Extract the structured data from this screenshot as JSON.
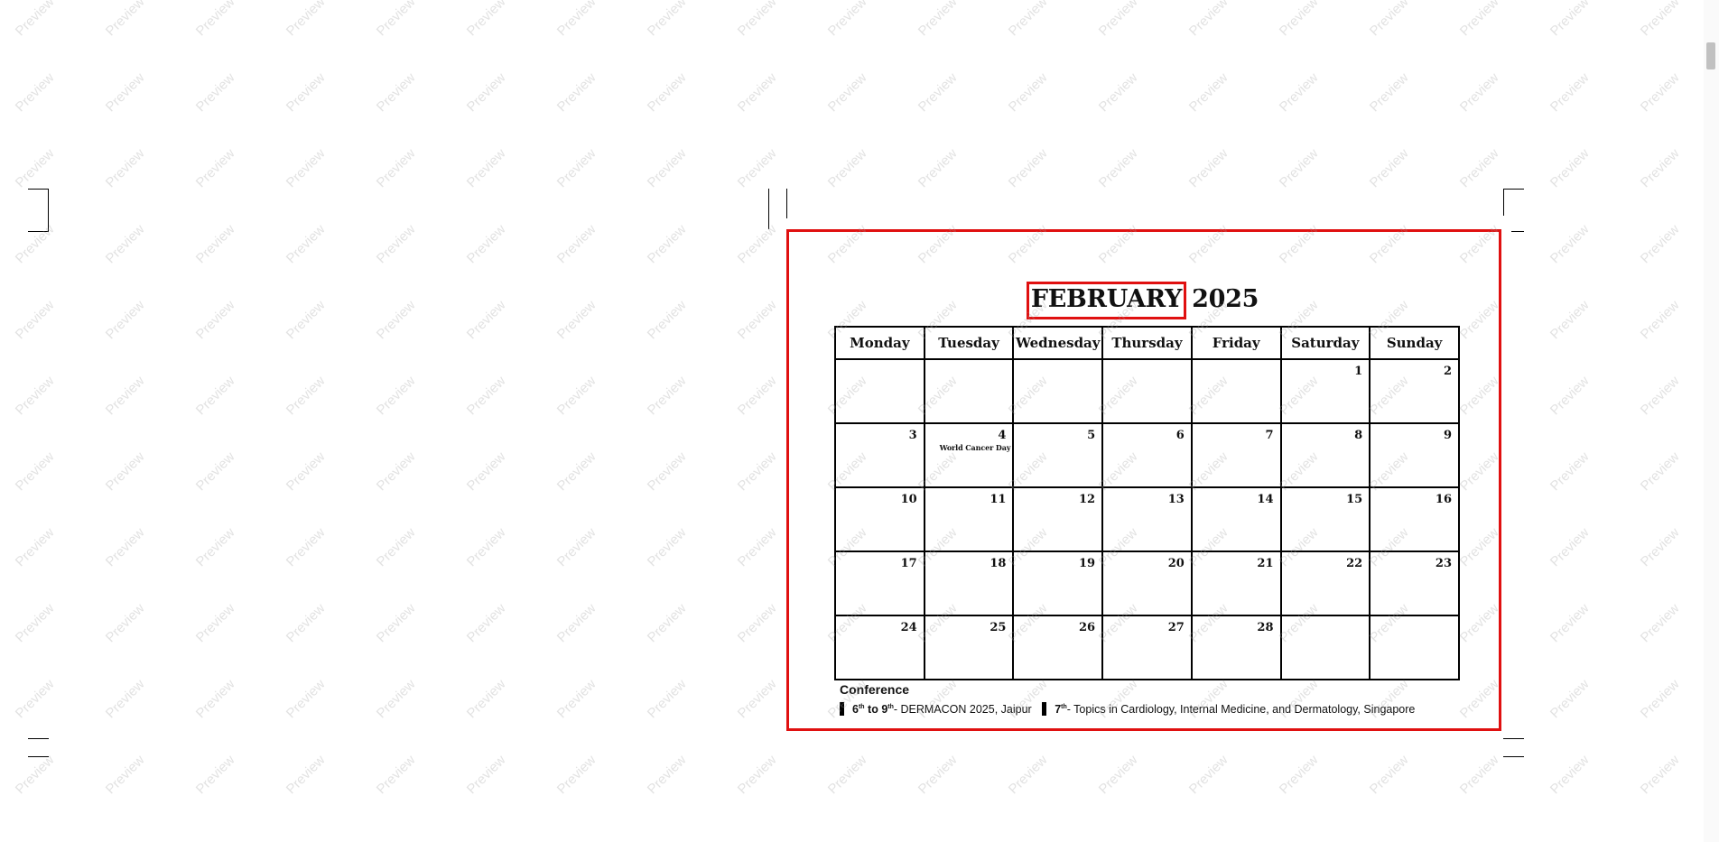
{
  "watermark_text": "Preview",
  "calendar": {
    "month": "FEBRUARY",
    "year": "2025",
    "days": [
      "Monday",
      "Tuesday",
      "Wednesday",
      "Thursday",
      "Friday",
      "Saturday",
      "Sunday"
    ],
    "weeks": [
      [
        "",
        "",
        "",
        "",
        "",
        "1",
        "2"
      ],
      [
        "3",
        "4",
        "5",
        "6",
        "7",
        "8",
        "9"
      ],
      [
        "10",
        "11",
        "12",
        "13",
        "14",
        "15",
        "16"
      ],
      [
        "17",
        "18",
        "19",
        "20",
        "21",
        "22",
        "23"
      ],
      [
        "24",
        "25",
        "26",
        "27",
        "28",
        "",
        ""
      ]
    ],
    "events": {
      "4": "World Cancer Day"
    }
  },
  "conference": {
    "heading": "Conference",
    "items": [
      {
        "range_start": "6",
        "range_start_sup": "th",
        "range_sep": " to ",
        "range_end": "9",
        "range_end_sup": "th",
        "text": "- DERMACON 2025, Jaipur"
      },
      {
        "range_start": "7",
        "range_start_sup": "th",
        "text": "- Topics in Cardiology, Internal Medicine, and Dermatology, Singapore"
      }
    ]
  }
}
